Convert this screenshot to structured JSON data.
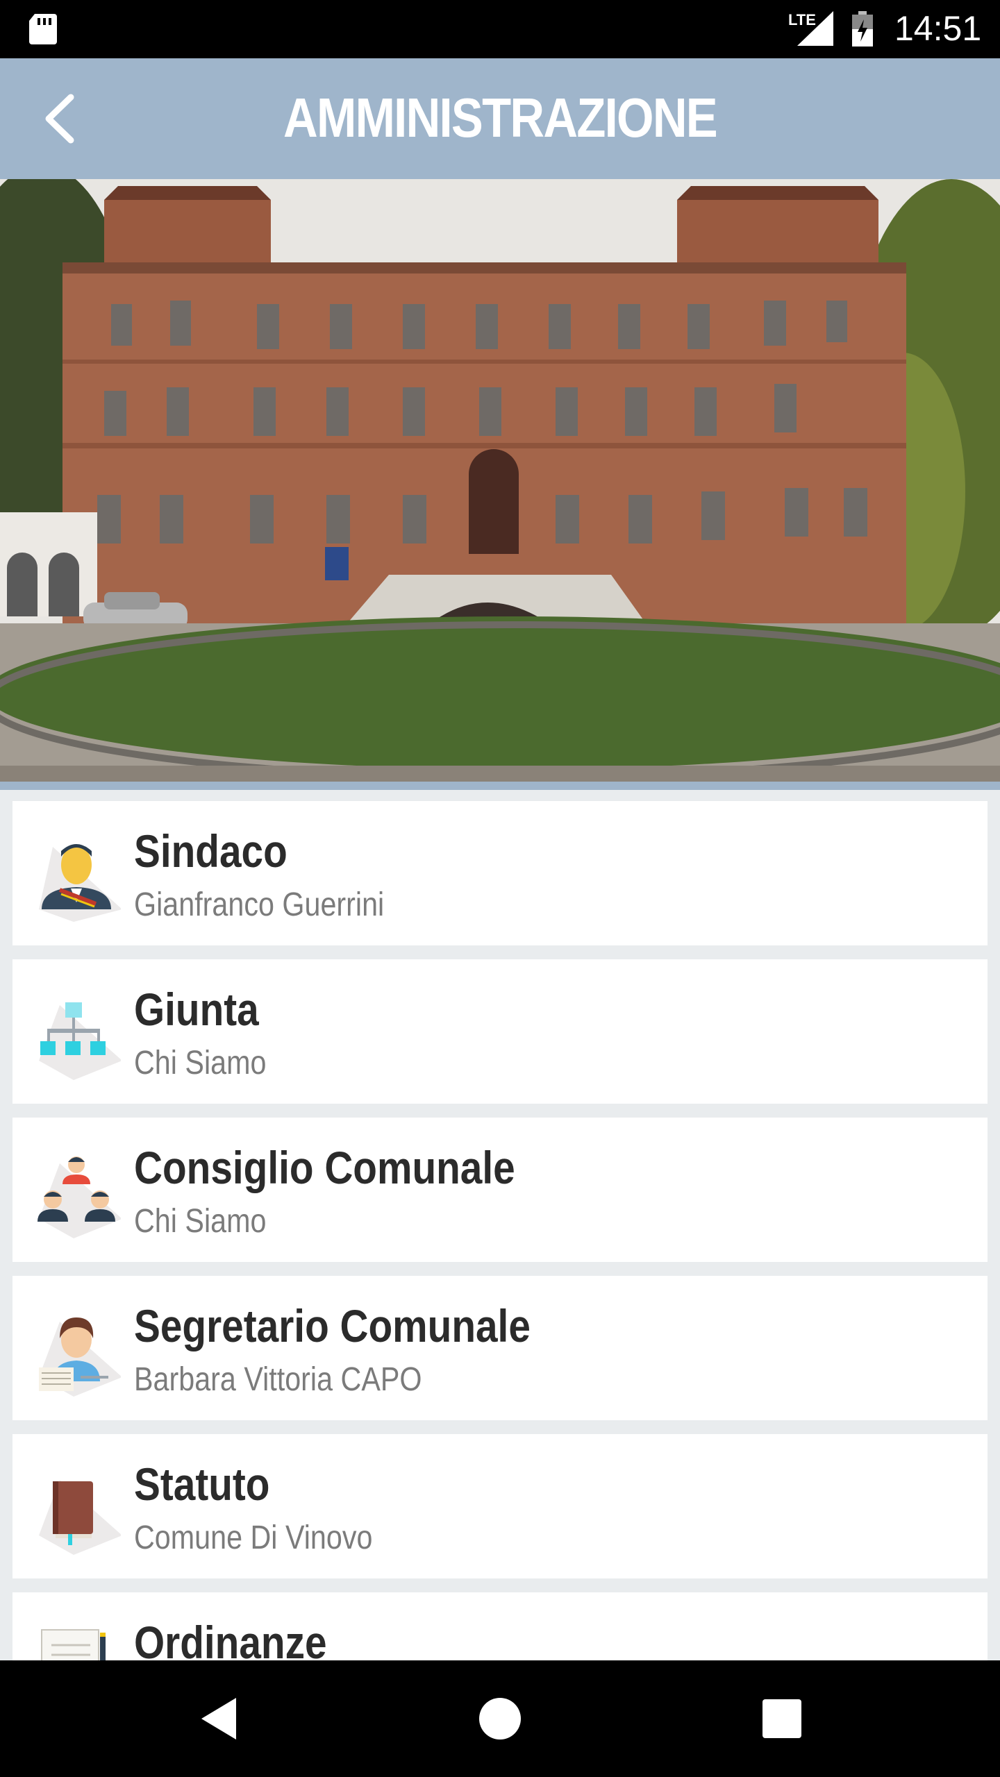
{
  "status_bar": {
    "network": "LTE",
    "time": "14:51"
  },
  "app_bar": {
    "title": "AMMINISTRAZIONE"
  },
  "menu": [
    {
      "title": "Sindaco",
      "subtitle": "Gianfranco Guerrini",
      "icon": "mayor-icon"
    },
    {
      "title": "Giunta",
      "subtitle": "Chi Siamo",
      "icon": "org-chart-icon"
    },
    {
      "title": "Consiglio Comunale",
      "subtitle": "Chi Siamo",
      "icon": "council-group-icon"
    },
    {
      "title": "Segretario Comunale",
      "subtitle": "Barbara Vittoria CAPO",
      "icon": "secretary-icon"
    },
    {
      "title": "Statuto",
      "subtitle": "Comune Di Vinovo",
      "icon": "book-icon"
    },
    {
      "title": "Ordinanze",
      "subtitle": "",
      "icon": "document-scroll-icon"
    }
  ],
  "colors": {
    "app_bar": "#9fb5cb",
    "background": "#e9ecee",
    "title_text": "#2b2b2b",
    "subtitle_text": "#7b7b7b"
  }
}
